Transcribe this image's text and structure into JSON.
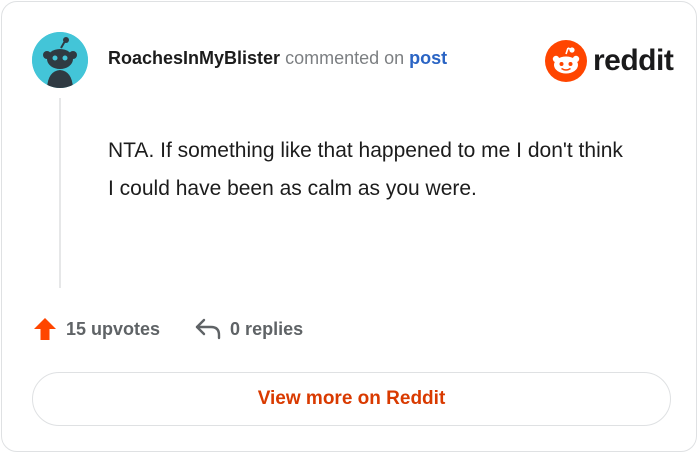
{
  "comment": {
    "username": "RoachesInMyBlister",
    "action": "commented on",
    "post_link": "post",
    "body": "NTA. If something like that happened to me I don't think I could have been as calm as you were.",
    "upvotes": "15 upvotes",
    "replies": "0 replies"
  },
  "brand": {
    "wordmark": "reddit"
  },
  "footer": {
    "view_more_label": "View more on Reddit"
  },
  "icons": {
    "avatar": "snoo-avatar",
    "logo": "reddit-logo-icon",
    "upvote": "upvote-arrow-icon",
    "reply": "reply-arrow-icon"
  },
  "colors": {
    "accent": "#d93a00",
    "upvote": "#ff4500",
    "link": "#2a64c4",
    "avatar_bg": "#43c5d8"
  }
}
